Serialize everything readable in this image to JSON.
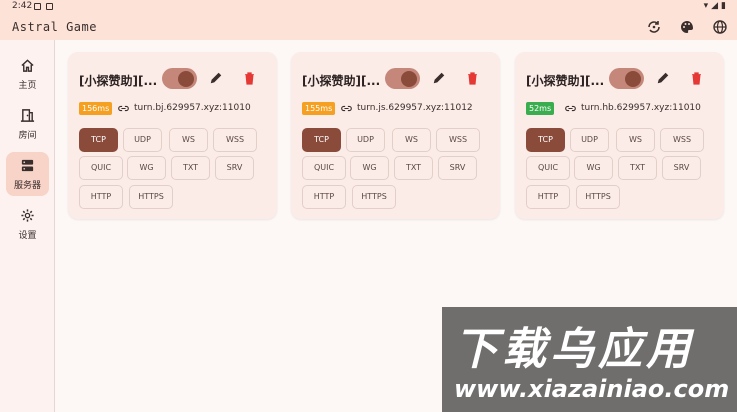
{
  "status_bar": {
    "time": "2:42"
  },
  "app": {
    "title": "Astral Game"
  },
  "sidebar": {
    "items": [
      {
        "label": "主页",
        "icon": "home-icon"
      },
      {
        "label": "房间",
        "icon": "room-icon"
      },
      {
        "label": "服务器",
        "icon": "server-icon",
        "active": true
      },
      {
        "label": "设置",
        "icon": "gear-icon"
      }
    ]
  },
  "servers": [
    {
      "name": "[小探赞助][...",
      "enabled": true,
      "latency": "156ms",
      "latency_color": "#f5a020",
      "address": "turn.bj.629957.xyz:11010",
      "protocols": [
        "TCP",
        "UDP",
        "WS",
        "WSS",
        "QUIC",
        "WG",
        "TXT",
        "SRV",
        "HTTP",
        "HTTPS"
      ],
      "selected_protocol": "TCP"
    },
    {
      "name": "[小探赞助][...",
      "enabled": true,
      "latency": "155ms",
      "latency_color": "#f5a020",
      "address": "turn.js.629957.xyz:11012",
      "protocols": [
        "TCP",
        "UDP",
        "WS",
        "WSS",
        "QUIC",
        "WG",
        "TXT",
        "SRV",
        "HTTP",
        "HTTPS"
      ],
      "selected_protocol": "TCP"
    },
    {
      "name": "[小探赞助][...",
      "enabled": true,
      "latency": "52ms",
      "latency_color": "#3aad4f",
      "address": "turn.hb.629957.xyz:11010",
      "protocols": [
        "TCP",
        "UDP",
        "WS",
        "WSS",
        "QUIC",
        "WG",
        "TXT",
        "SRV",
        "HTTP",
        "HTTPS"
      ],
      "selected_protocol": "TCP"
    }
  ],
  "watermark": {
    "line1": "下载乌应用",
    "line2": "www.xiazainiao.com"
  },
  "colors": {
    "accent": "#8a4b3b",
    "appbar": "#fde2d8",
    "delete": "#e53935"
  }
}
